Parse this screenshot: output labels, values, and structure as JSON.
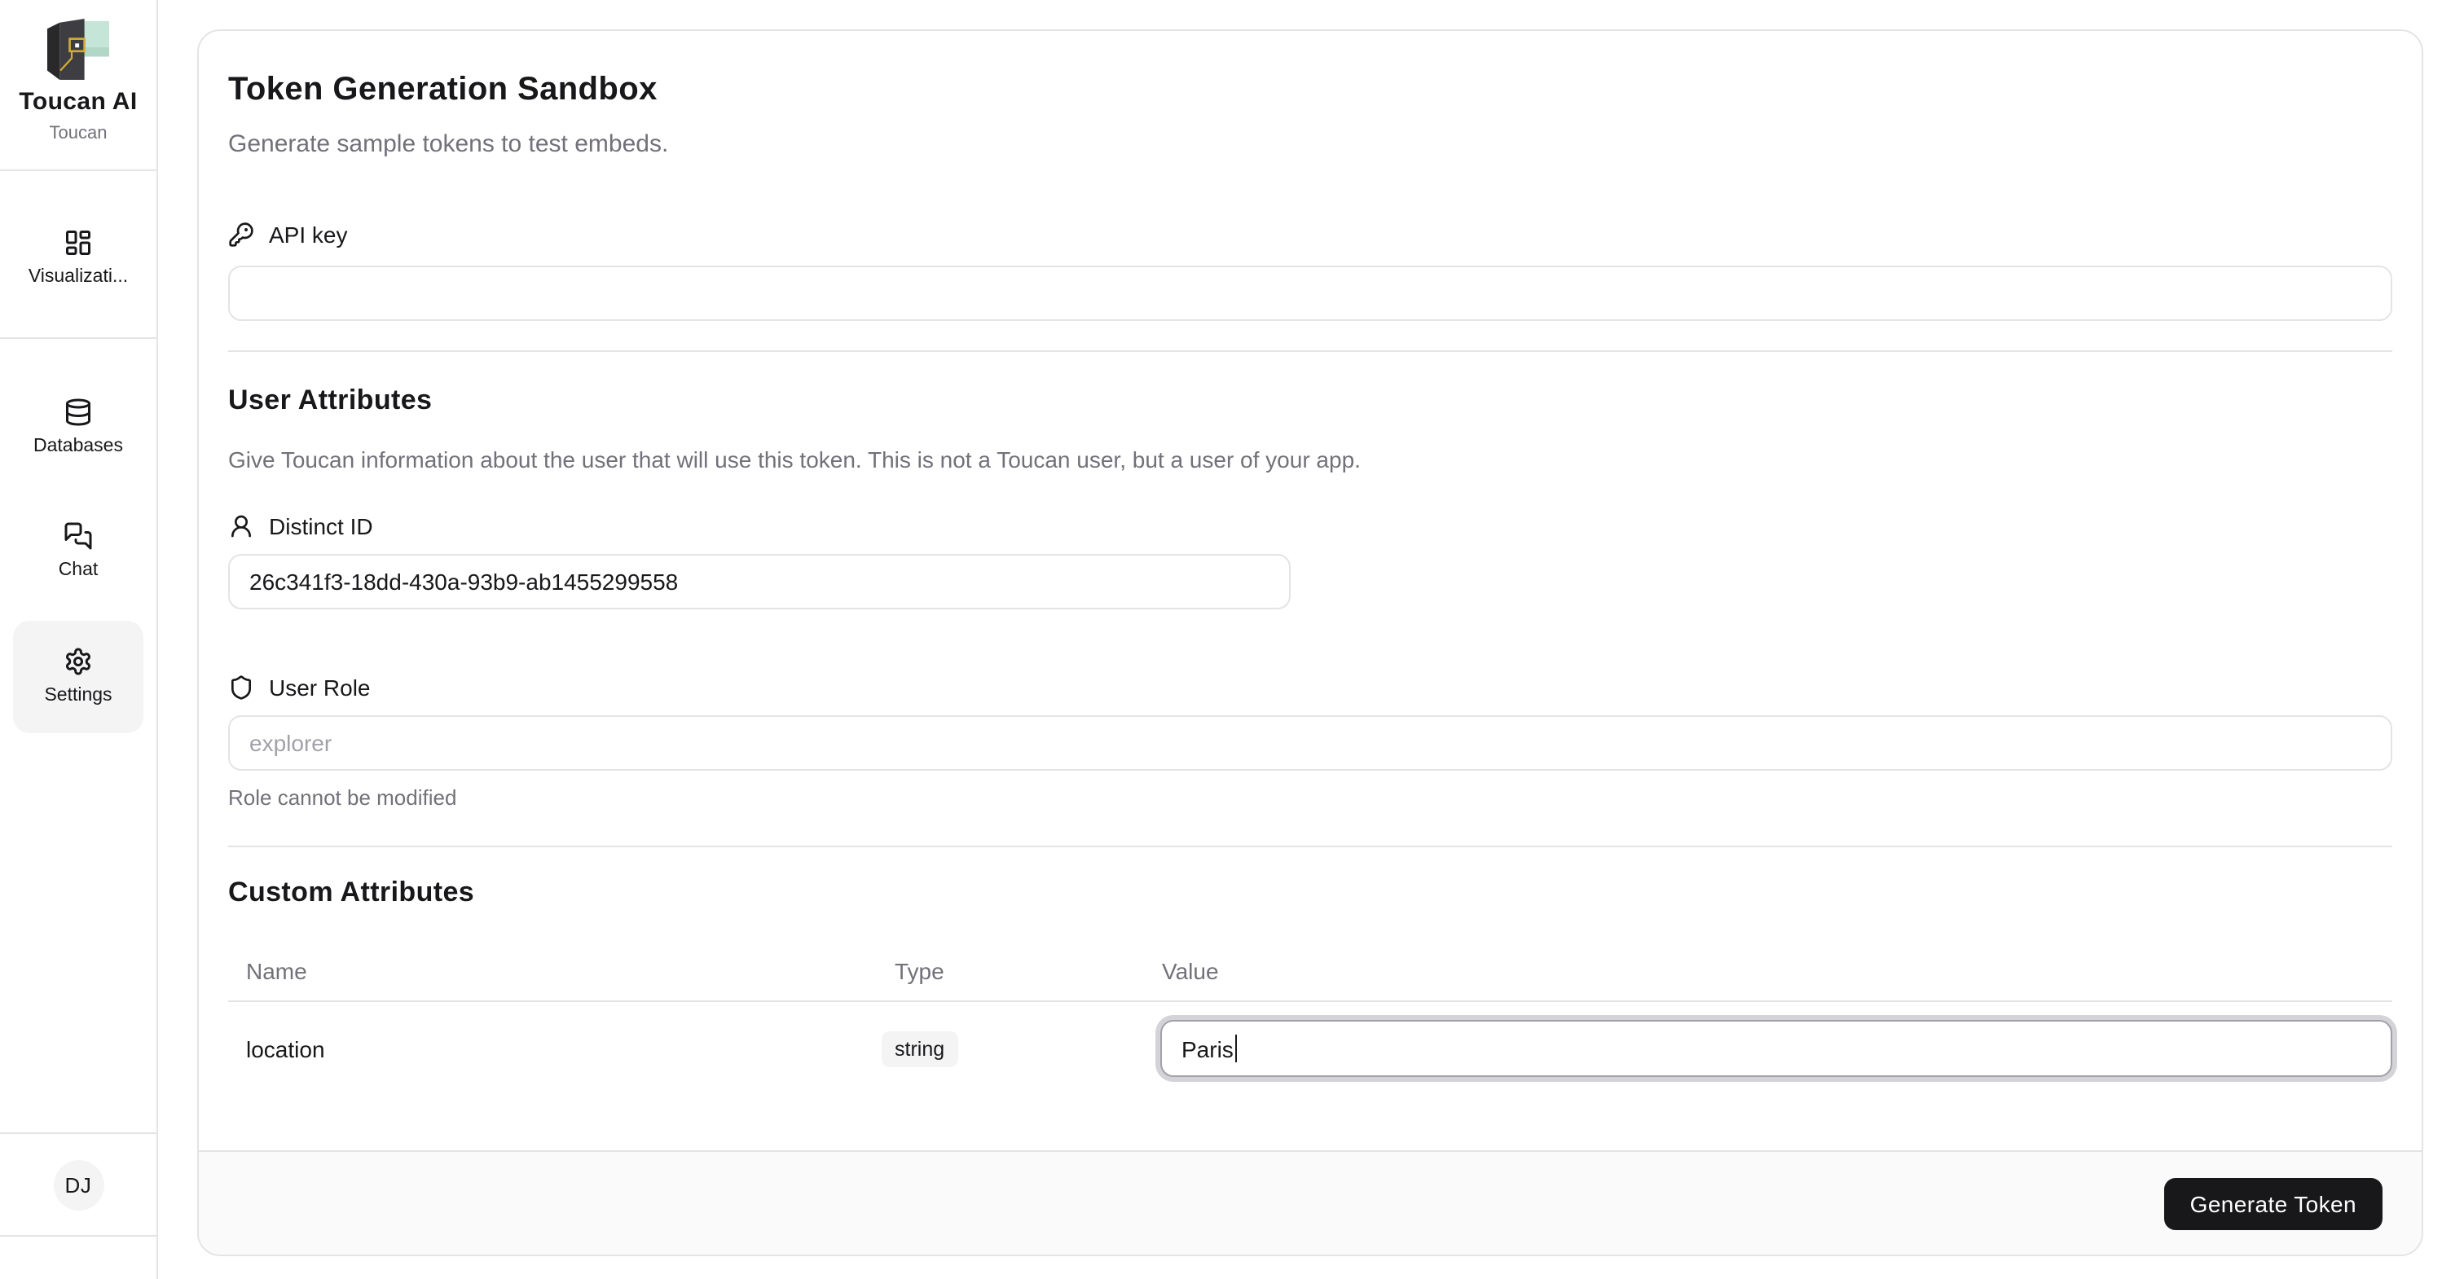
{
  "colors": {
    "primary_text": "#18181b",
    "muted_text": "#71717a",
    "placeholder_text": "#a1a1aa",
    "border": "#e4e4e7",
    "chip_bg": "#f4f4f5",
    "footer_bg": "#fafafa",
    "button_bg": "#18181b",
    "logo_mint": "#c5e5d8",
    "logo_yellow": "#d1ac33"
  },
  "sidebar": {
    "brand": {
      "title": "Toucan AI",
      "subtitle": "Toucan"
    },
    "items": [
      {
        "label": "Visualizati..."
      },
      {
        "label": "Databases"
      },
      {
        "label": "Chat"
      },
      {
        "label": "Settings"
      }
    ],
    "avatar_initials": "DJ"
  },
  "page": {
    "title": "Token Generation Sandbox",
    "subtitle": "Generate sample tokens to test embeds."
  },
  "api_key": {
    "label": "API key",
    "value": ""
  },
  "user_attributes": {
    "heading": "User Attributes",
    "description": "Give Toucan information about the user that will use this token. This is not a Toucan user, but a user of your app.",
    "distinct_id": {
      "label": "Distinct ID",
      "value": "26c341f3-18dd-430a-93b9-ab1455299558"
    },
    "user_role": {
      "label": "User Role",
      "placeholder": "explorer",
      "helper": "Role cannot be modified"
    }
  },
  "custom_attributes": {
    "heading": "Custom Attributes",
    "columns": [
      "Name",
      "Type",
      "Value"
    ],
    "rows": [
      {
        "name": "location",
        "type": "string",
        "value": "Paris"
      }
    ]
  },
  "footer": {
    "generate_button_label": "Generate Token"
  }
}
